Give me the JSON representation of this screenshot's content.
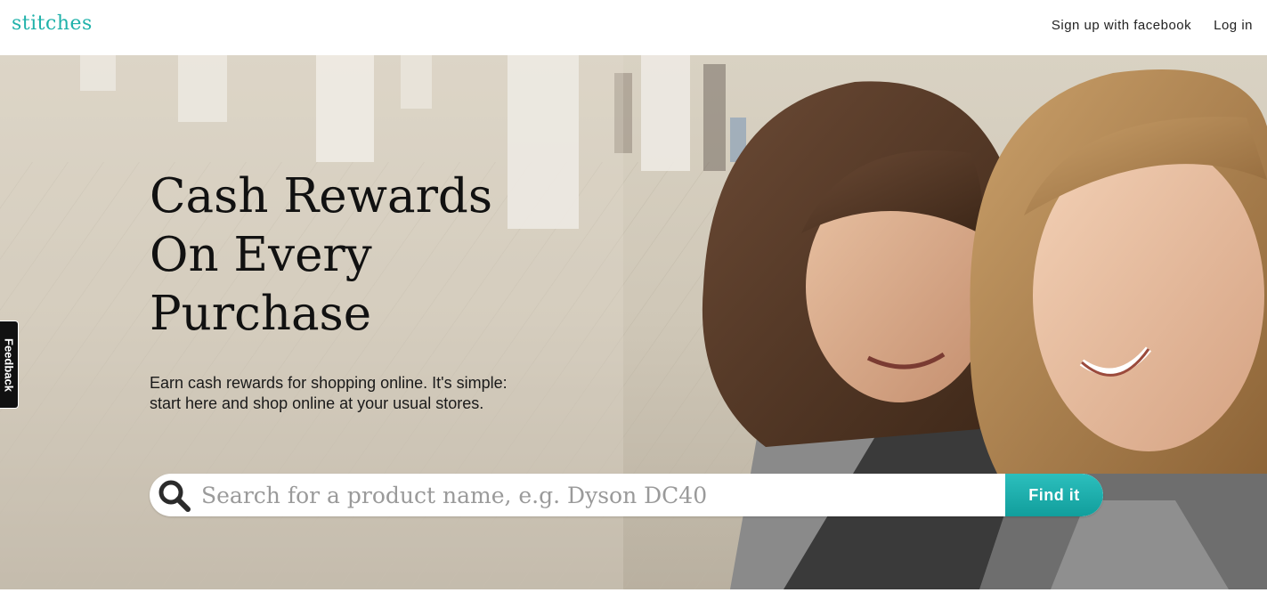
{
  "header": {
    "logo": "stitches",
    "signup_label": "Sign up with facebook",
    "login_label": "Log in"
  },
  "hero": {
    "title_line1": "Cash Rewards",
    "title_line2": "On Every",
    "title_line3": "Purchase",
    "subtitle": "Earn cash rewards for shopping online. It's simple: start here and shop online at your usual stores.",
    "search": {
      "placeholder": "Search for a product name, e.g. Dyson DC40",
      "value": "",
      "button_label": "Find it",
      "icon": "search-icon"
    }
  },
  "feedback": {
    "label": "Feedback"
  },
  "colors": {
    "brand": "#20b2aa",
    "button": "#16a7a5",
    "text": "#111111"
  }
}
